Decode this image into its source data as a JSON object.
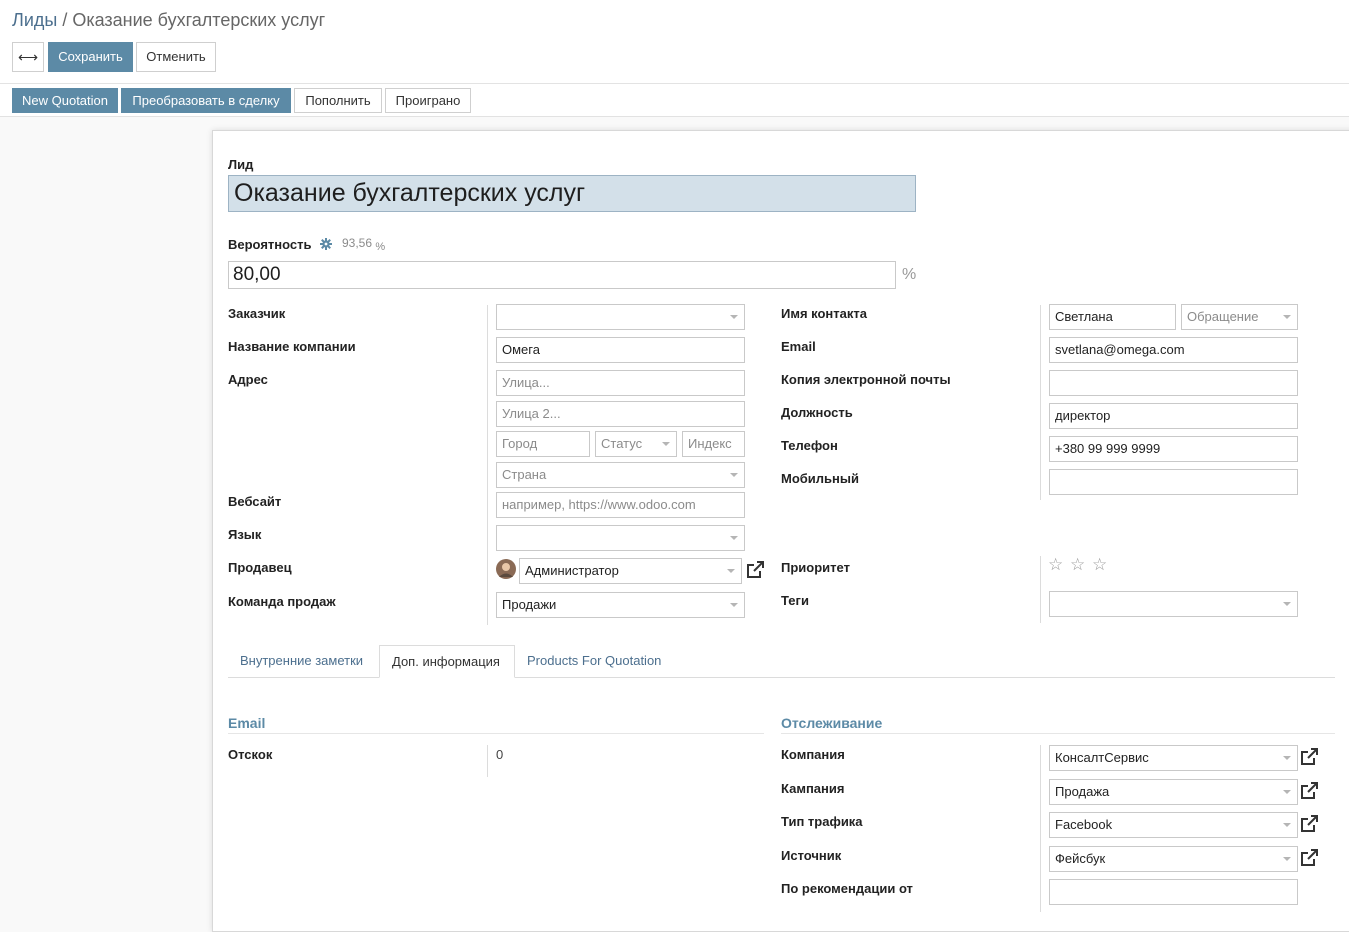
{
  "breadcrumb": {
    "root": "Лиды",
    "separator": " / ",
    "current": "Оказание бухгалтерских услуг"
  },
  "toolbar": {
    "toggle_label": "⟷",
    "save_label": "Сохранить",
    "cancel_label": "Отменить"
  },
  "actions": {
    "new_quotation": "New Quotation",
    "convert": "Преобразовать в сделку",
    "enrich": "Пополнить",
    "lost": "Проиграно"
  },
  "form": {
    "lead_label": "Лид",
    "lead_name": "Оказание бухгалтерских услуг",
    "probability_label": "Вероятность",
    "auto_probability": "93,56",
    "auto_probability_unit": "%",
    "probability_value": "80,00",
    "probability_unit": "%",
    "left": {
      "customer_label": "Заказчик",
      "company_name_label": "Название компании",
      "company_name": "Омега",
      "address_label": "Адрес",
      "street_ph": "Улица...",
      "street2_ph": "Улица 2...",
      "city_ph": "Город",
      "state_ph": "Статус",
      "zip_ph": "Индекс",
      "country_ph": "Страна",
      "website_label": "Вебсайт",
      "website_ph": "например, https://www.odoo.com",
      "language_label": "Язык",
      "salesperson_label": "Продавец",
      "salesperson": "Администратор",
      "team_label": "Команда продаж",
      "team": "Продажи"
    },
    "right": {
      "contact_name_label": "Имя контакта",
      "contact_name": "Светлана",
      "title_ph": "Обращение",
      "email_label": "Email",
      "email": "svetlana@omega.com",
      "email_cc_label": "Копия электронной почты",
      "job_label": "Должность",
      "job": "директор",
      "phone_label": "Телефон",
      "phone": "+380 99 999 9999",
      "mobile_label": "Мобильный",
      "priority_label": "Приоритет",
      "priority": 0,
      "priority_max": 3,
      "tags_label": "Теги"
    }
  },
  "tabs": [
    {
      "label": "Внутренние заметки",
      "active": false
    },
    {
      "label": "Доп. информация",
      "active": true
    },
    {
      "label": "Products For Quotation",
      "active": false
    }
  ],
  "extra": {
    "email_section": "Email",
    "bounce_label": "Отскок",
    "bounce_value": "0",
    "tracking_section": "Отслеживание",
    "company_label": "Компания",
    "company": "КонсалтСервис",
    "campaign_label": "Кампания",
    "campaign": "Продажа",
    "medium_label": "Тип трафика",
    "medium": "Facebook",
    "source_label": "Источник",
    "source": "Фейсбук",
    "referred_label": "По рекомендации от"
  },
  "colors": {
    "primary": "#5c8aa6",
    "link": "#4c6f8e",
    "title_bg": "#d3e0e9"
  },
  "icons": {
    "settings": "gear-icon",
    "external": "external-link-icon",
    "star": "star-outline-icon",
    "avatar": "avatar"
  }
}
